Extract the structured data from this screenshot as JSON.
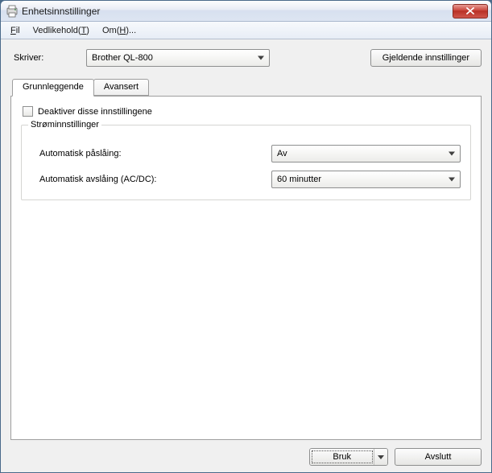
{
  "window": {
    "title": "Enhetsinnstillinger"
  },
  "menu": {
    "file": {
      "pre": "",
      "ul": "F",
      "post": "il"
    },
    "maintenance": {
      "pre": "Vedlikehold(",
      "ul": "T",
      "post": ")"
    },
    "about": {
      "pre": "Om(",
      "ul": "H",
      "post": ")..."
    }
  },
  "printer": {
    "label": "Skriver:",
    "value": "Brother QL-800"
  },
  "buttons": {
    "current_settings": "Gjeldende innstillinger",
    "apply": {
      "pre": "",
      "ul": "B",
      "post": "ruk"
    },
    "exit": {
      "pre": "Avs",
      "ul": "l",
      "post": "utt"
    }
  },
  "tabs": {
    "basic": "Grunnleggende",
    "advanced": "Avansert"
  },
  "panel": {
    "disable_checkbox": {
      "pre": "",
      "ul": "D",
      "post": "eaktiver disse innstillingene"
    },
    "power_group": "Strøminnstillinger",
    "auto_on_label": "Automatisk påslåing:",
    "auto_on_value": "Av",
    "auto_off_label": "Automatisk avslåing (AC/DC):",
    "auto_off_value": "60 minutter"
  }
}
